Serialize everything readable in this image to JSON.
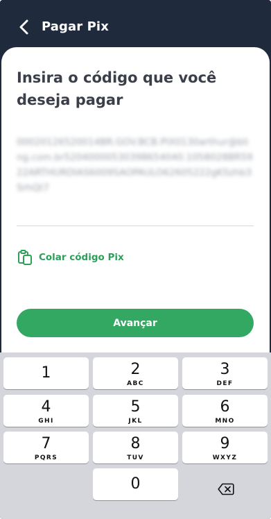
{
  "header": {
    "title": "Pagar Pix",
    "back_icon": "chevron-left-icon"
  },
  "main": {
    "prompt": "Insira o código que você deseja pagar",
    "code_value": "00020126520014BR.GOV.BCB.PIX0130arthur@bling.com.br52040000530398654040.1058028BR5922ARTHURDIAS6009SAOPAULO62605222gKSzhb3SrhQt7",
    "paste_label": "Colar código Pix",
    "paste_icon": "clipboard-icon",
    "advance_label": "Avançar"
  },
  "keyboard": {
    "keys": [
      {
        "digit": "1",
        "letters": ""
      },
      {
        "digit": "2",
        "letters": "ABC"
      },
      {
        "digit": "3",
        "letters": "DEF"
      },
      {
        "digit": "4",
        "letters": "GHI"
      },
      {
        "digit": "5",
        "letters": "JKL"
      },
      {
        "digit": "6",
        "letters": "MNO"
      },
      {
        "digit": "7",
        "letters": "PQRS"
      },
      {
        "digit": "8",
        "letters": "TUV"
      },
      {
        "digit": "9",
        "letters": "WXYZ"
      },
      {
        "digit": "0",
        "letters": ""
      }
    ],
    "delete_icon": "backspace-icon"
  },
  "colors": {
    "header_bg": "#1f2a3d",
    "accent_green": "#33a863",
    "link_green": "#2e9e5b",
    "keyboard_bg": "#d4d6dc"
  }
}
